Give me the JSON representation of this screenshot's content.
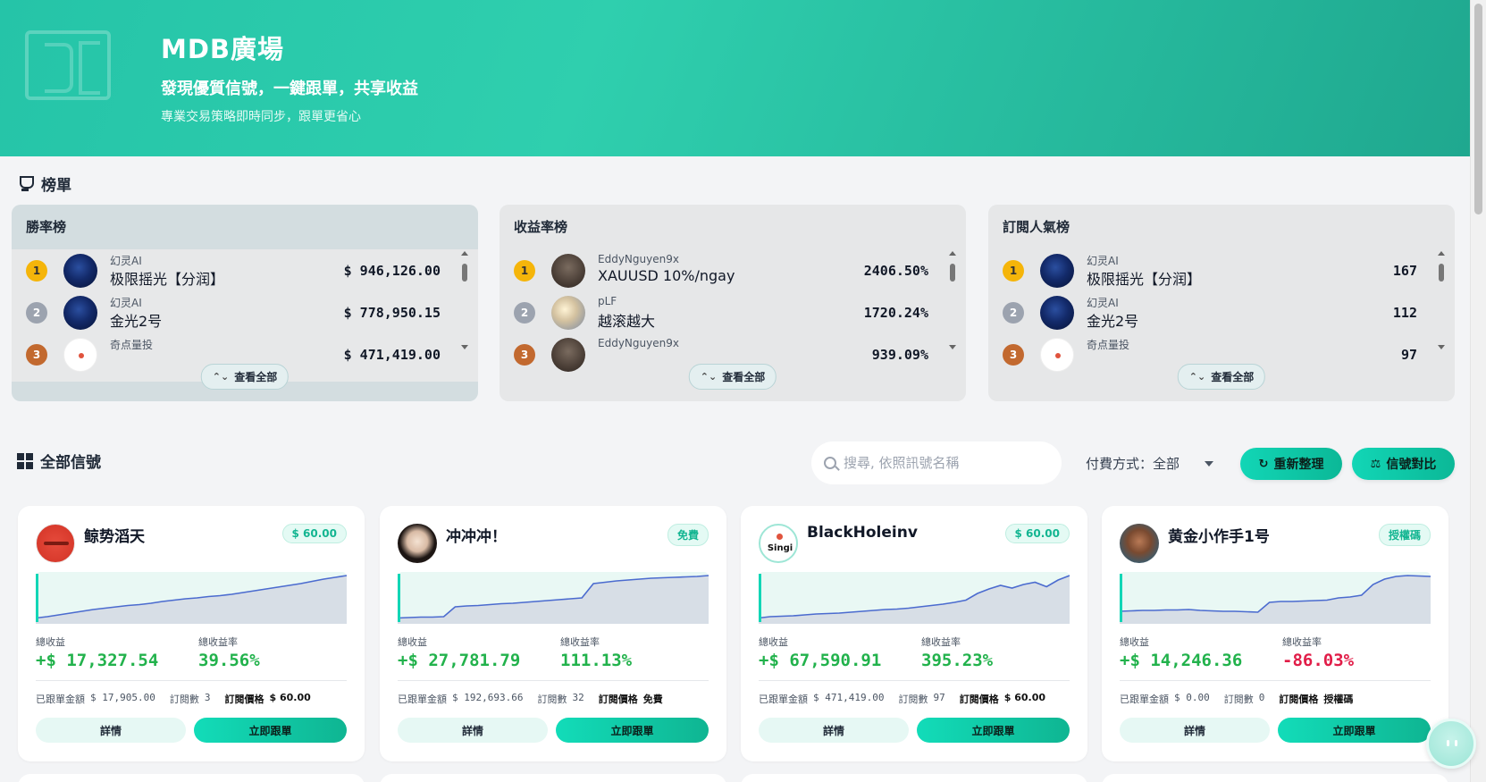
{
  "hero": {
    "title": "MDB廣場",
    "subtitle": "發現優質信號，一鍵跟單，共享收益",
    "description": "專業交易策略即時同步，跟單更省心"
  },
  "leaderboard": {
    "title": "榜單",
    "view_all": "查看全部",
    "boards": [
      {
        "title": "勝率榜",
        "rows": [
          {
            "rank": "1",
            "owner": "幻灵AI",
            "name": "极限摇光【分润】",
            "value": "$ 946,126.00"
          },
          {
            "rank": "2",
            "owner": "幻灵AI",
            "name": "金光2号",
            "value": "$ 778,950.15"
          },
          {
            "rank": "3",
            "owner": "奇点量投",
            "name": "",
            "value": "$ 471,419.00"
          }
        ]
      },
      {
        "title": "收益率榜",
        "rows": [
          {
            "rank": "1",
            "owner": "EddyNguyen9x",
            "name": "XAUUSD 10%/ngay",
            "value": "2406.50%"
          },
          {
            "rank": "2",
            "owner": "pLF",
            "name": "越滚越大",
            "value": "1720.24%"
          },
          {
            "rank": "3",
            "owner": "EddyNguyen9x",
            "name": "",
            "value": "939.09%"
          }
        ]
      },
      {
        "title": "訂閱人氣榜",
        "rows": [
          {
            "rank": "1",
            "owner": "幻灵AI",
            "name": "极限摇光【分润】",
            "value": "167"
          },
          {
            "rank": "2",
            "owner": "幻灵AI",
            "name": "金光2号",
            "value": "112"
          },
          {
            "rank": "3",
            "owner": "奇点量投",
            "name": "",
            "value": "97"
          }
        ]
      }
    ]
  },
  "signals": {
    "title": "全部信號",
    "search_placeholder": "搜尋, 依照訊號名稱",
    "payment_filter": "付費方式：全部",
    "refresh_label": "重新整理",
    "compare_label": "信號對比",
    "labels": {
      "total_profit": "總收益",
      "total_return": "總收益率",
      "followed_amount": "已跟單金額",
      "subscribers": "訂閱數",
      "sub_price": "訂閱價格",
      "detail": "詳情",
      "follow": "立即跟單"
    },
    "cards": [
      {
        "name": "鲸势滔天",
        "tag": "$ 60.00",
        "profit": "+$ 17,327.54",
        "return": "39.56%",
        "return_sign": "pos",
        "followed": "$ 17,905.00",
        "subs": "3",
        "price": "$ 60.00",
        "curve": [
          0.05,
          0.08,
          0.12,
          0.16,
          0.2,
          0.24,
          0.27,
          0.3,
          0.33,
          0.35,
          0.38,
          0.42,
          0.45,
          0.48,
          0.5,
          0.53,
          0.55,
          0.58,
          0.62,
          0.66,
          0.7,
          0.74,
          0.78,
          0.82,
          0.87,
          0.92,
          0.96,
          1.0
        ]
      },
      {
        "name": "冲冲冲！",
        "tag": "免費",
        "profit": "+$ 27,781.79",
        "return": "111.13%",
        "return_sign": "pos",
        "followed": "$ 192,693.66",
        "subs": "32",
        "price": "免費",
        "curve": [
          0.05,
          0.06,
          0.07,
          0.07,
          0.08,
          0.3,
          0.32,
          0.33,
          0.35,
          0.37,
          0.38,
          0.4,
          0.42,
          0.44,
          0.46,
          0.48,
          0.5,
          0.82,
          0.85,
          0.88,
          0.9,
          0.92,
          0.94,
          0.95,
          0.96,
          0.97,
          0.98,
          1.0
        ]
      },
      {
        "name": "BlackHoleinv",
        "tag": "$ 60.00",
        "profit": "+$ 67,590.91",
        "return": "395.23%",
        "return_sign": "pos",
        "followed": "$ 471,419.00",
        "subs": "97",
        "price": "$ 60.00",
        "curve": [
          0.05,
          0.08,
          0.09,
          0.1,
          0.12,
          0.14,
          0.15,
          0.16,
          0.18,
          0.2,
          0.22,
          0.24,
          0.25,
          0.27,
          0.3,
          0.33,
          0.36,
          0.4,
          0.45,
          0.6,
          0.7,
          0.78,
          0.72,
          0.8,
          0.85,
          0.75,
          0.9,
          1.0
        ]
      },
      {
        "name": "黄金小作手1号",
        "tag": "授權碼",
        "profit": "+$ 14,246.36",
        "return": "-86.03%",
        "return_sign": "neg",
        "followed": "$ 0.00",
        "subs": "0",
        "price": "授權碼",
        "curve": [
          0.2,
          0.21,
          0.22,
          0.22,
          0.23,
          0.23,
          0.24,
          0.22,
          0.21,
          0.2,
          0.2,
          0.19,
          0.18,
          0.4,
          0.42,
          0.42,
          0.43,
          0.44,
          0.45,
          0.5,
          0.52,
          0.56,
          0.8,
          0.92,
          0.98,
          1.0,
          0.99,
          0.98
        ]
      }
    ]
  },
  "colors": {
    "accent": "#12d6b6",
    "positive": "#22b24c",
    "negative": "#e11d48",
    "chart_line": "#4b6bcf",
    "chart_fill": "#d7dee6"
  },
  "icons": {
    "trophy": "trophy-icon",
    "grid": "grid-icon",
    "search": "search-icon",
    "refresh": "refresh-icon",
    "compare": "compare-icon",
    "chat": "chat-bot-icon"
  }
}
